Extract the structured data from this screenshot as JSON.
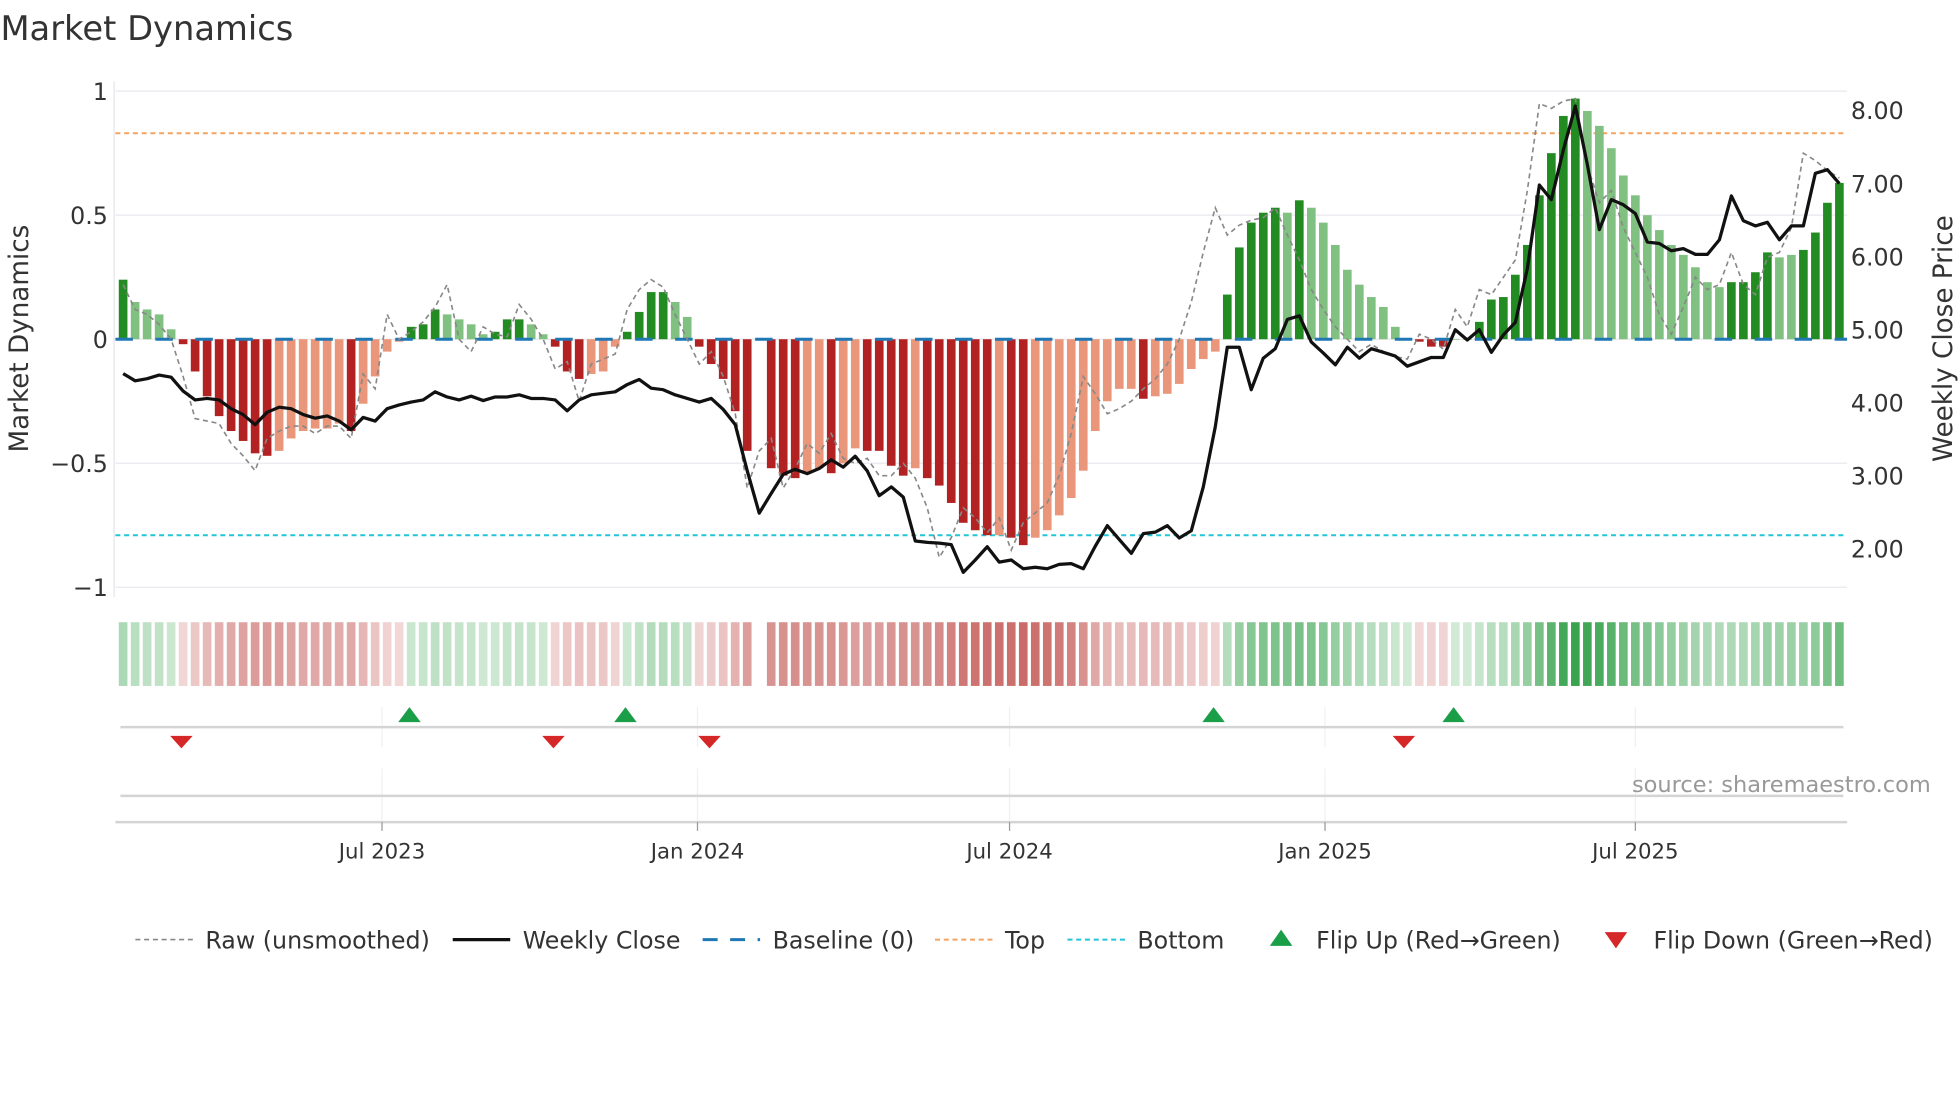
{
  "title": "Market Dynamics",
  "source": "source: sharemaestro.com",
  "chart_data": {
    "type": "bar",
    "title": "Market Dynamics",
    "ylabel": "Market Dynamics",
    "y2label": "Weekly Close Price",
    "ylim": [
      -1.04,
      1.04
    ],
    "y2lim": [
      1.34,
      8.4
    ],
    "start_date": "2023-01-31",
    "interval_days": 7,
    "top_threshold": 0.83,
    "bottom_threshold": -0.79,
    "baseline": 0,
    "yticks": [
      {
        "v": 1,
        "label": "1"
      },
      {
        "v": 0.5,
        "label": "0.5"
      },
      {
        "v": 0,
        "label": "0"
      },
      {
        "v": -0.5,
        "label": "−0.5"
      },
      {
        "v": -1,
        "label": "−1"
      }
    ],
    "y2ticks": [
      {
        "v": 8,
        "label": "8.00"
      },
      {
        "v": 7,
        "label": "7.00"
      },
      {
        "v": 6,
        "label": "6.00"
      },
      {
        "v": 5,
        "label": "5.00"
      },
      {
        "v": 4,
        "label": "4.00"
      },
      {
        "v": 3,
        "label": "3.00"
      },
      {
        "v": 2,
        "label": "2.00"
      }
    ],
    "xticks": [
      {
        "date": "2023-07-01",
        "label": "Jul 2023"
      },
      {
        "date": "2024-01-01",
        "label": "Jan 2024"
      },
      {
        "date": "2024-07-01",
        "label": "Jul 2024"
      },
      {
        "date": "2025-01-01",
        "label": "Jan 2025"
      },
      {
        "date": "2025-07-01",
        "label": "Jul 2025"
      }
    ],
    "momentum": [
      0.24,
      0.15,
      0.12,
      0.1,
      0.04,
      -0.02,
      -0.13,
      -0.23,
      -0.31,
      -0.37,
      -0.41,
      -0.46,
      -0.47,
      -0.45,
      -0.4,
      -0.37,
      -0.36,
      -0.36,
      -0.34,
      -0.37,
      -0.26,
      -0.15,
      -0.05,
      -0.01,
      0.05,
      0.06,
      0.12,
      0.1,
      0.08,
      0.06,
      0.02,
      0.03,
      0.08,
      0.08,
      0.06,
      0.02,
      -0.03,
      -0.13,
      -0.16,
      -0.14,
      -0.13,
      -0.03,
      0.03,
      0.11,
      0.19,
      0.19,
      0.15,
      0.09,
      -0.03,
      -0.1,
      -0.16,
      -0.29,
      -0.45,
      null,
      -0.52,
      -0.55,
      -0.56,
      -0.54,
      -0.52,
      -0.54,
      -0.5,
      -0.44,
      -0.45,
      -0.45,
      -0.51,
      -0.55,
      -0.52,
      -0.56,
      -0.59,
      -0.66,
      -0.74,
      -0.77,
      -0.79,
      -0.79,
      -0.8,
      -0.83,
      -0.8,
      -0.77,
      -0.71,
      -0.64,
      -0.53,
      -0.37,
      -0.25,
      -0.2,
      -0.2,
      -0.24,
      -0.23,
      -0.22,
      -0.18,
      -0.12,
      -0.08,
      -0.05,
      0.18,
      0.37,
      0.47,
      0.51,
      0.53,
      0.51,
      0.56,
      0.53,
      0.47,
      0.38,
      0.28,
      0.22,
      0.17,
      0.13,
      0.05,
      0.0,
      -0.01,
      -0.03,
      -0.03,
      0.0,
      0.0,
      0.07,
      0.16,
      0.17,
      0.26,
      0.38,
      0.58,
      0.75,
      0.9,
      0.97,
      0.92,
      0.86,
      0.77,
      0.66,
      0.58,
      0.5,
      0.44,
      0.38,
      0.34,
      0.29,
      0.23,
      0.21,
      0.23,
      0.23,
      0.27,
      0.35,
      0.33,
      0.34,
      0.36,
      0.43,
      0.55,
      0.63
    ],
    "strong": [
      1,
      0,
      0,
      0,
      0,
      1,
      1,
      1,
      1,
      1,
      1,
      1,
      1,
      0,
      0,
      0,
      0,
      0,
      0,
      1,
      0,
      0,
      0,
      0,
      1,
      1,
      1,
      0,
      0,
      0,
      0,
      1,
      1,
      1,
      0,
      0,
      1,
      1,
      1,
      0,
      0,
      0,
      1,
      1,
      1,
      1,
      0,
      0,
      1,
      1,
      1,
      1,
      1,
      0,
      1,
      1,
      1,
      0,
      0,
      1,
      0,
      0,
      1,
      1,
      1,
      1,
      0,
      1,
      1,
      1,
      1,
      1,
      1,
      0,
      1,
      1,
      0,
      0,
      0,
      0,
      0,
      0,
      0,
      0,
      0,
      1,
      0,
      0,
      0,
      0,
      0,
      0,
      1,
      1,
      1,
      1,
      1,
      0,
      1,
      0,
      0,
      0,
      0,
      0,
      0,
      0,
      0,
      0,
      1,
      1,
      1,
      0,
      0,
      1,
      1,
      1,
      1,
      1,
      1,
      1,
      1,
      1,
      0,
      0,
      0,
      0,
      0,
      0,
      0,
      0,
      0,
      0,
      0,
      0,
      1,
      1,
      1,
      1,
      0,
      0,
      1,
      1,
      1,
      1
    ],
    "raw": [
      0.22,
      0.12,
      0.1,
      0.06,
      0.0,
      -0.15,
      -0.32,
      -0.33,
      -0.34,
      -0.42,
      -0.47,
      -0.53,
      -0.4,
      -0.37,
      -0.35,
      -0.35,
      -0.38,
      -0.35,
      -0.35,
      -0.4,
      -0.14,
      -0.2,
      0.1,
      0.0,
      0.03,
      0.07,
      0.13,
      0.22,
      0.0,
      -0.05,
      0.05,
      0.02,
      0.01,
      0.14,
      0.08,
      0.0,
      -0.12,
      -0.09,
      -0.25,
      -0.1,
      -0.08,
      -0.06,
      0.12,
      0.2,
      0.24,
      0.21,
      0.1,
      0.0,
      -0.1,
      -0.05,
      -0.15,
      -0.3,
      -0.6,
      -0.45,
      -0.4,
      -0.6,
      -0.52,
      -0.42,
      -0.46,
      -0.38,
      -0.48,
      -0.5,
      -0.48,
      -0.55,
      -0.55,
      -0.5,
      -0.56,
      -0.68,
      -0.88,
      -0.8,
      -0.68,
      -0.72,
      -0.78,
      -0.72,
      -0.85,
      -0.74,
      -0.7,
      -0.66,
      -0.55,
      -0.38,
      -0.15,
      -0.22,
      -0.3,
      -0.28,
      -0.25,
      -0.2,
      -0.16,
      -0.1,
      0.0,
      0.15,
      0.35,
      0.53,
      0.42,
      0.46,
      0.48,
      0.49,
      0.53,
      0.42,
      0.32,
      0.2,
      0.12,
      0.05,
      0.0,
      -0.05,
      -0.02,
      -0.05,
      -0.07,
      -0.08,
      0.02,
      0.0,
      -0.04,
      0.12,
      0.05,
      0.2,
      0.18,
      0.25,
      0.32,
      0.6,
      0.95,
      0.93,
      0.96,
      0.97,
      0.7,
      0.55,
      0.6,
      0.45,
      0.35,
      0.25,
      0.1,
      0.02,
      0.13,
      0.25,
      0.2,
      0.22,
      0.35,
      0.22,
      0.18,
      0.33,
      0.35,
      0.45,
      0.75,
      0.72,
      0.68,
      0.65
    ],
    "close": [
      4.4,
      4.3,
      4.33,
      4.38,
      4.35,
      4.16,
      4.04,
      4.06,
      4.04,
      3.92,
      3.84,
      3.7,
      3.87,
      3.94,
      3.92,
      3.84,
      3.79,
      3.82,
      3.75,
      3.63,
      3.8,
      3.75,
      3.92,
      3.97,
      4.01,
      4.04,
      4.15,
      4.08,
      4.04,
      4.09,
      4.03,
      4.08,
      4.08,
      4.11,
      4.06,
      4.06,
      4.04,
      3.89,
      4.04,
      4.11,
      4.13,
      4.15,
      4.25,
      4.32,
      4.2,
      4.18,
      4.11,
      4.06,
      4.01,
      4.06,
      3.91,
      3.7,
      3.07,
      2.49,
      2.76,
      3.02,
      3.09,
      3.03,
      3.1,
      3.22,
      3.12,
      3.27,
      3.07,
      2.73,
      2.85,
      2.71,
      2.11,
      2.09,
      2.08,
      2.06,
      1.68,
      1.85,
      2.03,
      1.82,
      1.85,
      1.73,
      1.75,
      1.73,
      1.79,
      1.8,
      1.73,
      2.04,
      2.32,
      2.13,
      1.94,
      2.21,
      2.23,
      2.32,
      2.15,
      2.25,
      2.85,
      3.67,
      4.76,
      4.76,
      4.18,
      4.61,
      4.74,
      5.14,
      5.19,
      4.83,
      4.68,
      4.52,
      4.76,
      4.61,
      4.74,
      4.69,
      4.64,
      4.5,
      4.56,
      4.62,
      4.62,
      5.0,
      4.86,
      5.0,
      4.69,
      4.93,
      5.1,
      5.84,
      6.98,
      6.78,
      7.46,
      8.06,
      7.26,
      6.37,
      6.78,
      6.71,
      6.59,
      6.2,
      6.18,
      6.08,
      6.11,
      6.03,
      6.03,
      6.23,
      6.83,
      6.49,
      6.42,
      6.47,
      6.23,
      6.42,
      6.42,
      7.14,
      7.19,
      7.0
    ],
    "flips_up": [
      "2023-07-17",
      "2023-11-20",
      "2024-10-28",
      "2025-03-17"
    ],
    "flips_down": [
      "2023-03-06",
      "2023-10-09",
      "2024-01-08",
      "2025-02-16"
    ],
    "colors": {
      "strong_up": "#228b22",
      "weak_up": "#80c080",
      "strong_down": "#b22222",
      "weak_down": "#e9967a",
      "close": "#111111",
      "raw": "#888888",
      "baseline": "#1f77b4",
      "top": "#f4a460",
      "bottom": "#22c5d8",
      "flip_up": "#1a9e48",
      "flip_down": "#d62728"
    },
    "legend": [
      {
        "key": "raw",
        "label": "Raw (unsmoothed)"
      },
      {
        "key": "close",
        "label": "Weekly Close"
      },
      {
        "key": "baseline",
        "label": "Baseline (0)"
      },
      {
        "key": "top",
        "label": "Top"
      },
      {
        "key": "bottom",
        "label": "Bottom"
      },
      {
        "key": "flip_up",
        "label": "Flip Up (Red→Green)"
      },
      {
        "key": "flip_down",
        "label": "Flip Down (Green→Red)"
      }
    ]
  }
}
